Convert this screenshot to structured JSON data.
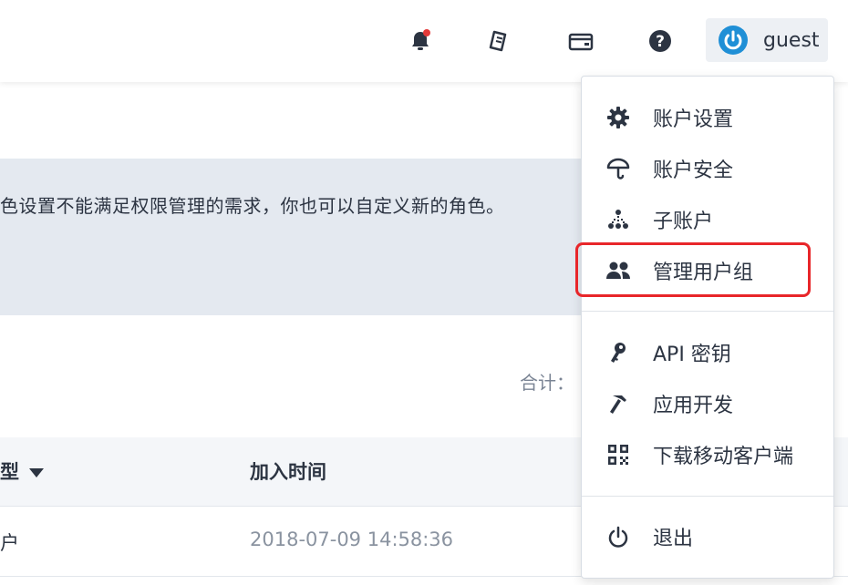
{
  "header": {
    "icons": [
      {
        "name": "notification-bell-icon",
        "badge_color": "#e33a3a"
      },
      {
        "name": "ticket-icon"
      },
      {
        "name": "wallet-icon"
      },
      {
        "name": "help-icon"
      }
    ],
    "user": {
      "name": "guest",
      "avatar_icon": "power-icon",
      "accent": "#1f8fd6"
    }
  },
  "main": {
    "notice_text": "色设置不能满足权限管理的需求，你也可以自定义新的角色。",
    "total_label": "合计：",
    "table": {
      "columns": [
        "型",
        "加入时间"
      ],
      "rows": [
        {
          "type": "户",
          "joined": "2018-07-09 14:58:36"
        }
      ]
    }
  },
  "dropdown": {
    "group1": [
      {
        "icon": "gear-icon",
        "label": "账户设置"
      },
      {
        "icon": "umbrella-icon",
        "label": "账户安全"
      },
      {
        "icon": "sub-account-icon",
        "label": "子账户"
      },
      {
        "icon": "user-group-icon",
        "label": "管理用户组",
        "highlighted": true
      }
    ],
    "group2": [
      {
        "icon": "key-icon",
        "label": "API 密钥"
      },
      {
        "icon": "hammer-icon",
        "label": "应用开发"
      },
      {
        "icon": "qr-code-icon",
        "label": "下载移动客户端"
      }
    ],
    "group3": [
      {
        "icon": "power-icon",
        "label": "退出"
      }
    ],
    "highlight_color": "#e8262a"
  }
}
